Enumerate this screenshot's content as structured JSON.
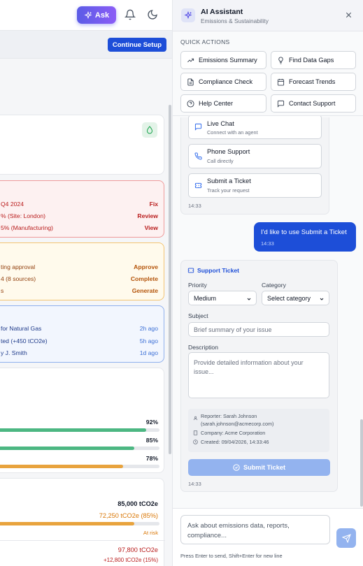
{
  "topbar": {
    "ask_label": "Ask"
  },
  "setup": {
    "continue_label": "Continue Setup"
  },
  "alerts_red": [
    {
      "text": "Q4 2024",
      "action": "Fix"
    },
    {
      "text": "% (Site: London)",
      "action": "Review"
    },
    {
      "text": "5% (Manufacturing)",
      "action": "View"
    }
  ],
  "alerts_orange": [
    {
      "text": "ting approval",
      "action": "Approve"
    },
    {
      "text": "4 (8 sources)",
      "action": "Complete"
    },
    {
      "text": "s",
      "action": "Generate"
    }
  ],
  "activity": [
    {
      "text": "for Natural Gas",
      "time": "2h ago"
    },
    {
      "text": "ted (+450 tCO2e)",
      "time": "5h ago"
    },
    {
      "text": "y J. Smith",
      "time": "1d ago"
    }
  ],
  "progress": [
    {
      "pct_label": "92%",
      "fraction": 0.92,
      "color": "#4cb782"
    },
    {
      "pct_label": "85%",
      "fraction": 0.85,
      "color": "#4cb782"
    },
    {
      "pct_label": "78%",
      "fraction": 0.78,
      "color": "#e8a33d"
    }
  ],
  "targets": {
    "target_value": "85,000 tCO2e",
    "current_value": "72,250 tCO2e (85%)",
    "current_fraction": 0.85,
    "status": "At risk",
    "projected_value": "97,800 tCO2e",
    "delta": "+12,800 tCO2e (15%)"
  },
  "panel": {
    "title": "AI Assistant",
    "subtitle": "Emissions & Sustainability",
    "quick_actions_title": "QUICK ACTIONS",
    "quick_actions": [
      {
        "label": "Emissions Summary",
        "icon": "trend-icon"
      },
      {
        "label": "Find Data Gaps",
        "icon": "lightbulb-icon"
      },
      {
        "label": "Compliance Check",
        "icon": "document-icon"
      },
      {
        "label": "Forecast Trends",
        "icon": "calendar-icon"
      },
      {
        "label": "Help Center",
        "icon": "help-icon"
      },
      {
        "label": "Contact Support",
        "icon": "chat-icon"
      }
    ],
    "support_options": [
      {
        "title": "Live Chat",
        "sub": "Connect with an agent",
        "icon": "chat-icon"
      },
      {
        "title": "Phone Support",
        "sub": "Call directly",
        "icon": "phone-icon"
      },
      {
        "title": "Submit a Ticket",
        "sub": "Track your request",
        "icon": "ticket-icon"
      }
    ],
    "bot_time_1": "14:33",
    "user_message": "I'd like to use Submit a Ticket",
    "user_time": "14:33",
    "form": {
      "title": "Support Ticket",
      "priority_label": "Priority",
      "priority_value": "Medium",
      "category_label": "Category",
      "category_placeholder": "Select category",
      "subject_label": "Subject",
      "subject_placeholder": "Brief summary of your issue",
      "description_label": "Description",
      "description_placeholder": "Provide detailed information about your issue...",
      "reporter": "Reporter: Sarah Johnson",
      "reporter_email": "(sarah.johnson@acmecorp.com)",
      "company": "Company: Acme Corporation",
      "created": "Created: 09/04/2026, 14:33:46",
      "submit_label": "Submit Ticket"
    },
    "bot_time_2": "14:33",
    "input_placeholder": "Ask about emissions data, reports, compliance...",
    "hint": "Press Enter to send, Shift+Enter for new line"
  }
}
